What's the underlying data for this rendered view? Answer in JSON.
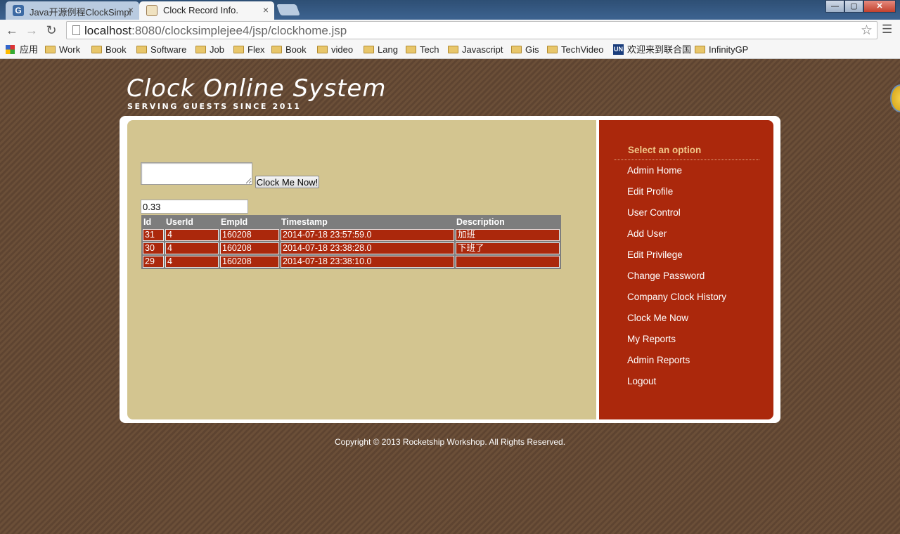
{
  "browser": {
    "tabs": [
      {
        "title": "Java开源例程ClockSimpl",
        "favicon": "G",
        "active": false
      },
      {
        "title": "Clock Record Info.",
        "active": true
      }
    ],
    "window_controls": {
      "minimize": "—",
      "maximize": "▢",
      "close": "✕"
    },
    "url_host": "localhost",
    "url_rest": ":8080/clocksimplejee4/jsp/clockhome.jsp",
    "bookmarks": [
      {
        "label": "应用",
        "icon": "apps-icon"
      },
      {
        "label": "Work",
        "icon": "folder-icon"
      },
      {
        "label": "Book",
        "icon": "folder-icon"
      },
      {
        "label": "Software",
        "icon": "folder-icon"
      },
      {
        "label": "Job",
        "icon": "folder-icon"
      },
      {
        "label": "Flex",
        "icon": "folder-icon"
      },
      {
        "label": "Book",
        "icon": "folder-icon"
      },
      {
        "label": "video",
        "icon": "folder-icon"
      },
      {
        "label": "Lang",
        "icon": "folder-icon"
      },
      {
        "label": "Tech",
        "icon": "folder-icon"
      },
      {
        "label": "Javascript",
        "icon": "folder-icon"
      },
      {
        "label": "Gis",
        "icon": "folder-icon"
      },
      {
        "label": "TechVideo",
        "icon": "folder-icon"
      },
      {
        "label": "欢迎来到联合国",
        "icon": "un-icon",
        "icon_text": "UN"
      },
      {
        "label": "InfinityGP",
        "icon": "folder-icon"
      }
    ]
  },
  "site": {
    "title": "Clock Online System",
    "tagline": "SERVING GUESTS SINCE 2011"
  },
  "clock_form": {
    "description_value": "",
    "button_label": "Clock Me Now!",
    "value_field": "0.33"
  },
  "table": {
    "headers": [
      "Id",
      "UserId",
      "EmpId",
      "Timestamp",
      "Description"
    ],
    "rows": [
      [
        "31",
        "4",
        "160208",
        "2014-07-18 23:57:59.0",
        "加班"
      ],
      [
        "30",
        "4",
        "160208",
        "2014-07-18 23:38:28.0",
        "下班了"
      ],
      [
        "29",
        "4",
        "160208",
        "2014-07-18 23:38:10.0",
        ""
      ]
    ]
  },
  "menu": {
    "heading": "Select an option",
    "items": [
      "Admin Home",
      "Edit Profile",
      "User Control",
      "Add User",
      "Edit Privilege",
      "Change Password",
      "Company Clock History",
      "Clock Me Now",
      "My Reports",
      "Admin Reports",
      "Logout"
    ]
  },
  "footer": {
    "copyright": "Copyright © 2013 Rocketship Workshop. All Rights Reserved."
  },
  "colors": {
    "page_background": "#6b4f38",
    "content_panel": "#d3c590",
    "sidebar": "#ab280c",
    "table_header": "#7d7d7d",
    "menu_heading": "#f0c88a"
  }
}
